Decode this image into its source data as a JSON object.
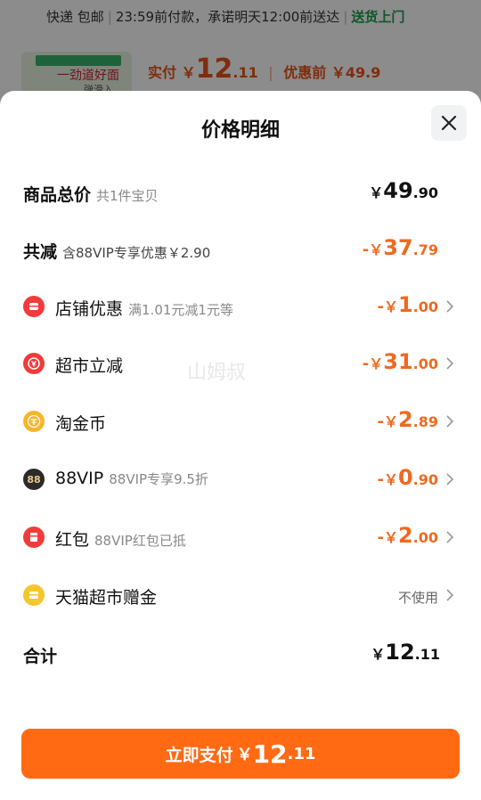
{
  "background": {
    "shipping_method": "快递 包邮",
    "shipping_promise": "23:59前付款，承诺明天12:00前送达",
    "delivery_tag": "送货上门",
    "thumb_text_1": "一劲道好面",
    "thumb_text_2": "弹滑入",
    "paid_label": "实付",
    "paid_currency": "￥",
    "paid_int": "12",
    "paid_dec": ".11",
    "before_label": "优惠前",
    "before_amount": "￥49.9"
  },
  "sheet": {
    "title": "价格明细",
    "close_icon": "close-icon",
    "watermark": "山姆叔"
  },
  "rows": {
    "total": {
      "label": "商品总价",
      "sub": "共1件宝贝",
      "currency": "￥",
      "int": "49",
      "dec": ".90"
    },
    "reduction": {
      "label": "共减",
      "sub": "含88VIP专享优惠￥2.90",
      "neg": "-",
      "currency": "￥",
      "int": "37",
      "dec": ".79"
    },
    "shop": {
      "label": "店铺优惠",
      "sub": "满1.01元减1元等",
      "neg": "-",
      "currency": "￥",
      "int": "1",
      "dec": ".00",
      "icon": "shop-icon"
    },
    "supermarket": {
      "label": "超市立减",
      "neg": "-",
      "currency": "￥",
      "int": "31",
      "dec": ".00",
      "icon": "coupon-icon"
    },
    "taojin": {
      "label": "淘金币",
      "neg": "-",
      "currency": "￥",
      "int": "2",
      "dec": ".89",
      "icon": "coin-icon"
    },
    "vip": {
      "label": "88VIP",
      "sub": "88VIP专享9.5折",
      "neg": "-",
      "currency": "￥",
      "int": "0",
      "dec": ".90",
      "icon": "88vip-icon",
      "icon_text": "88"
    },
    "redpacket": {
      "label": "红包",
      "sub": "88VIP红包已抵",
      "neg": "-",
      "currency": "￥",
      "int": "2",
      "dec": ".00",
      "icon": "red-packet-icon"
    },
    "gift": {
      "label": "天猫超市赠金",
      "status": "不使用",
      "icon": "gift-card-icon"
    },
    "sum": {
      "label": "合计",
      "currency": "￥",
      "int": "12",
      "dec": ".11"
    }
  },
  "pay_button": {
    "label": "立即支付",
    "currency": "￥",
    "int": "12",
    "dec": ".11"
  },
  "colors": {
    "accent": "#ff6a13",
    "discount": "#ee6a1f",
    "green": "#1f9b4a"
  }
}
